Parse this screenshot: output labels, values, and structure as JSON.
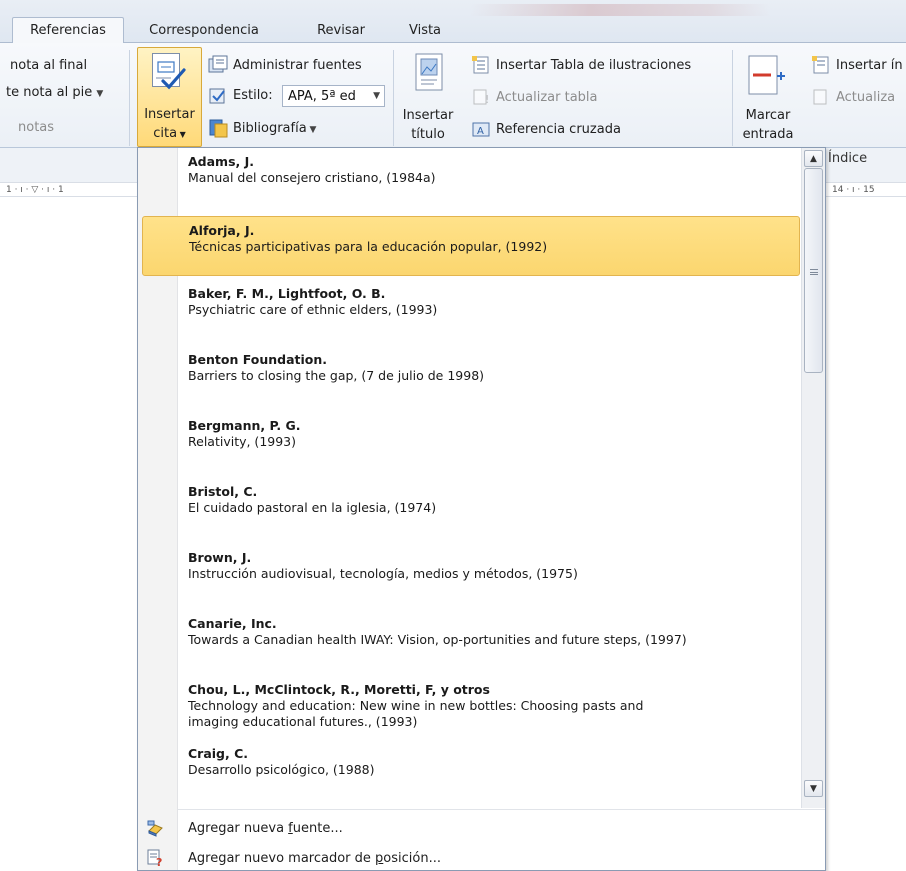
{
  "tabs": [
    {
      "label": "Referencias",
      "active": true
    },
    {
      "label": "Correspondencia",
      "active": false
    },
    {
      "label": "Revisar",
      "active": false
    },
    {
      "label": "Vista",
      "active": false
    }
  ],
  "ribbon": {
    "footnotes": {
      "insert_endnote": "nota al final",
      "next_footnote": "te nota al pie",
      "group_label": "notas"
    },
    "citations": {
      "insert_cite_line1": "Insertar",
      "insert_cite_line2": "cita",
      "manage_sources": "Administrar fuentes",
      "style_label": "Estilo:",
      "style_value": "APA, 5ª ed",
      "bibliography": "Bibliografía"
    },
    "captions": {
      "insert_caption_line1": "Insertar",
      "insert_caption_line2": "título",
      "insert_table_of_figures": "Insertar Tabla de ilustraciones",
      "update_table": "Actualizar tabla",
      "cross_reference": "Referencia cruzada"
    },
    "index": {
      "mark_entry_line1": "Marcar",
      "mark_entry_line2": "entrada",
      "insert_index": "Insertar ín",
      "update_index": "Actualiza",
      "group_label": "Índice"
    }
  },
  "ruler": {
    "left_text": "1 · ı · ▽ · ı · 1",
    "right_text": "14 · ı · 15"
  },
  "citations_list": [
    {
      "author": "Adams, J.",
      "title": "Manual del consejero cristiano, (1984a)"
    },
    {
      "author": "Alforja, J.",
      "title": "Técnicas participativas para la educación popular, (1992)",
      "selected": true
    },
    {
      "author": "Baker, F. M.,  Lightfoot, O. B.",
      "title": "Psychiatric care of ethnic elders, (1993)"
    },
    {
      "author": "Benton Foundation.",
      "title": "Barriers to closing the gap, (7 de julio de 1998)"
    },
    {
      "author": "Bergmann, P. G.",
      "title": "Relativity, (1993)"
    },
    {
      "author": "Bristol, C.",
      "title": "El cuidado pastoral en la iglesia, (1974)"
    },
    {
      "author": "Brown, J.",
      "title": "Instrucción audiovisual, tecnología, medios y métodos, (1975)"
    },
    {
      "author": "Canarie, Inc.",
      "title": "Towards a Canadian health IWAY: Vision, op-portunities and future steps, (1997)"
    },
    {
      "author": "Chou, L., McClintock, R., Moretti, F, y otros",
      "title": "Technology and education: New wine in new bottles: Choosing pasts and",
      "title2": "imaging educational futures., (1993)"
    },
    {
      "author": "Craig, C.",
      "title": "Desarrollo psicológico, (1988)"
    }
  ],
  "actions": {
    "add_source_pre": "Agregar nueva ",
    "add_source_key": "f",
    "add_source_post": "uente...",
    "add_placeholder_pre": "Agregar nuevo marcador de ",
    "add_placeholder_key": "p",
    "add_placeholder_post": "osición..."
  },
  "colors": {
    "selection": "#fbd66f",
    "ribbon_bg": "#ebf0f6",
    "accent_border": "#d8a93a"
  }
}
